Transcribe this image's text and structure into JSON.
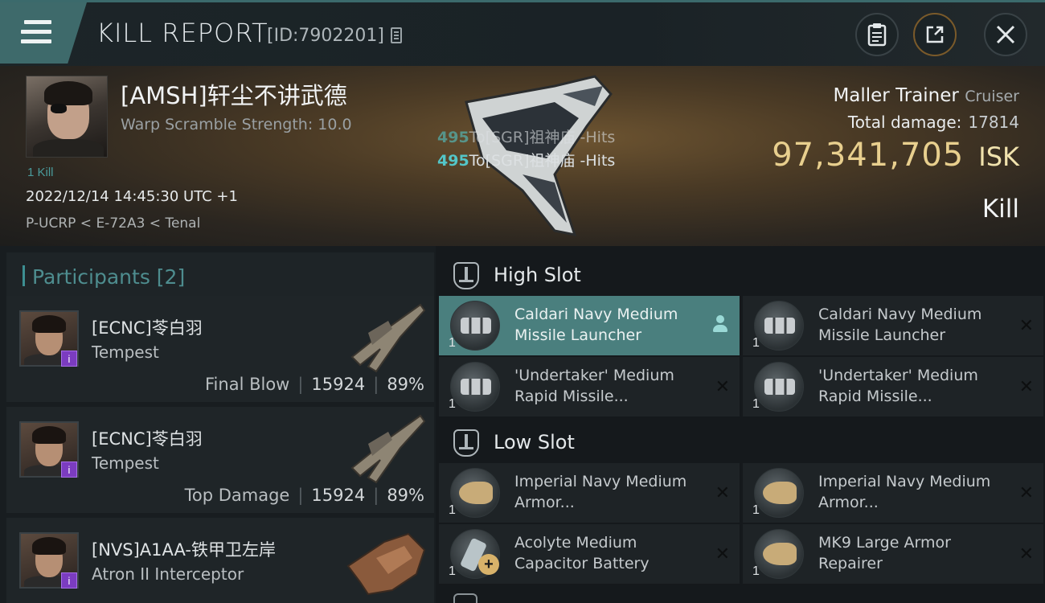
{
  "header": {
    "title": "KILL REPORT",
    "report_id": "[ID:7902201]",
    "buttons": {
      "clipboard_icon": "clipboard-icon",
      "share_icon": "share-icon",
      "close_icon": "close-icon"
    }
  },
  "victim": {
    "name": "[AMSH]轩尘不讲武德",
    "subtitle": "Warp Scramble Strength: 10.0",
    "kill_count": "1 Kill",
    "timestamp": "2022/12/14 14:45:30 UTC +1",
    "location": "P-UCRP < E-72A3 < Tenal",
    "ship_name": "Maller Trainer",
    "ship_class": "Cruiser",
    "total_damage_label": "Total damage:",
    "total_damage": "17814",
    "isk_value": "97,341,705",
    "isk_unit": "ISK",
    "kill_type": "Kill",
    "hits": [
      {
        "num": "495",
        "text": "To[SGR]祖神庙 -Hits"
      },
      {
        "num": "495",
        "text": "To[SGR]祖神庙 -Hits"
      }
    ]
  },
  "participants": {
    "label": "Participants [2]",
    "items": [
      {
        "name": "[ECNC]苓白羽",
        "ship": "Tempest",
        "tag": "Final Blow",
        "damage": "15924",
        "percent": "89%"
      },
      {
        "name": "[ECNC]苓白羽",
        "ship": "Tempest",
        "tag": "Top Damage",
        "damage": "15924",
        "percent": "89%"
      },
      {
        "name": "[NVS]A1AA-铁甲卫左岸",
        "ship": "Atron II Interceptor"
      }
    ]
  },
  "fitting": {
    "high_slot": {
      "label": "High Slot",
      "modules": [
        {
          "name": "Caldari Navy Medium Missile Launcher",
          "qty": "1",
          "active": true
        },
        {
          "name": "Caldari Navy Medium Missile Launcher",
          "qty": "1"
        },
        {
          "name": "'Undertaker' Medium Rapid Missile...",
          "qty": "1"
        },
        {
          "name": "'Undertaker' Medium Rapid Missile...",
          "qty": "1"
        }
      ]
    },
    "low_slot": {
      "label": "Low Slot",
      "modules": [
        {
          "name": "Imperial Navy Medium Armor...",
          "qty": "1"
        },
        {
          "name": "Imperial Navy Medium Armor...",
          "qty": "1"
        },
        {
          "name": "Acolyte Medium Capacitor Battery",
          "qty": "1"
        },
        {
          "name": "MK9 Large Armor Repairer",
          "qty": "1"
        }
      ]
    },
    "destroyed_mark": "✕"
  },
  "colors": {
    "accent_teal": "#4a7f7e",
    "isk_gold": "#e8cf8e",
    "hit_number": "#53c6c8"
  }
}
